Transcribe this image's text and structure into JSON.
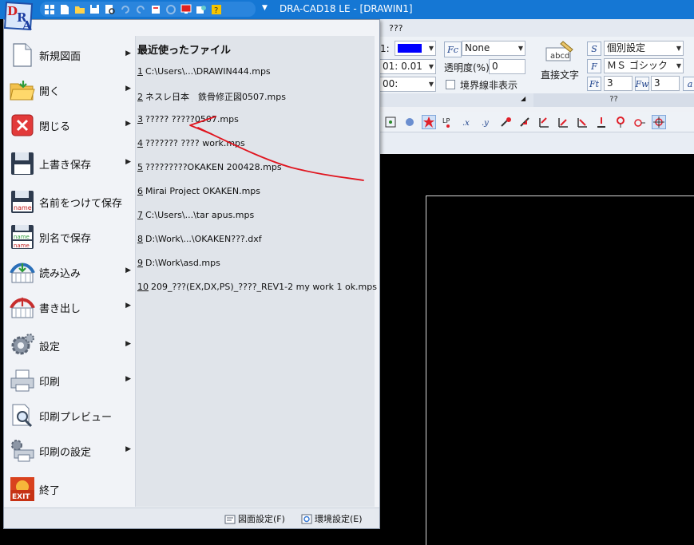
{
  "window": {
    "title": "DRA-CAD18 LE - [DRAWIN1]",
    "accent": "#1577d4"
  },
  "menubar": {
    "visible_item": "???"
  },
  "ribbon": {
    "line_color_label": "1:",
    "line_color_swatch": "#0000ff",
    "line_scale": "01: 0.01",
    "line_style_label": "00:",
    "fill_value": "None",
    "transparency_label": "透明度(%)",
    "transparency_value": "0",
    "hide_border_label": "境界線非表示",
    "direct_text_label": "直接文字",
    "style_value": "個別設定",
    "font_value": "ＭＳ ゴシック",
    "size1_value": "3",
    "size2_value": "3",
    "group_caption": "??"
  },
  "app_menu": {
    "items": [
      {
        "label": "新規図面",
        "icon": "new-document-icon",
        "has_submenu": true
      },
      {
        "label": "開く",
        "icon": "open-folder-icon",
        "has_submenu": true
      },
      {
        "label": "閉じる",
        "icon": "close-red-x-icon",
        "has_submenu": true
      },
      {
        "label": "上書き保存",
        "icon": "save-disk-icon",
        "has_submenu": true
      },
      {
        "label": "名前をつけて保存",
        "icon": "save-as-icon",
        "has_submenu": false
      },
      {
        "label": "別名で保存",
        "icon": "save-copy-icon",
        "has_submenu": false
      },
      {
        "label": "読み込み",
        "icon": "import-icon",
        "has_submenu": true
      },
      {
        "label": "書き出し",
        "icon": "export-icon",
        "has_submenu": true
      },
      {
        "label": "設定",
        "icon": "settings-gear-icon",
        "has_submenu": true
      },
      {
        "label": "印刷",
        "icon": "printer-icon",
        "has_submenu": true
      },
      {
        "label": "印刷プレビュー",
        "icon": "print-preview-icon",
        "has_submenu": false
      },
      {
        "label": "印刷の設定",
        "icon": "print-settings-icon",
        "has_submenu": true
      },
      {
        "label": "終了",
        "icon": "exit-icon",
        "has_submenu": false
      }
    ],
    "recent": {
      "title": "最近使ったファイル",
      "files": [
        {
          "num": "1",
          "name": "C:\\Users\\...\\DRAWIN444.mps"
        },
        {
          "num": "2",
          "name": "ネスレ日本　鉄骨修正図0507.mps"
        },
        {
          "num": "3",
          "name": "????? ?????0507.mps"
        },
        {
          "num": "4",
          "name": "??????? ???? work.mps"
        },
        {
          "num": "5",
          "name": "?????????OKAKEN 200428.mps"
        },
        {
          "num": "6",
          "name": "Mirai Project OKAKEN.mps"
        },
        {
          "num": "7",
          "name": "C:\\Users\\...\\tar apus.mps"
        },
        {
          "num": "8",
          "name": "D:\\Work\\...\\OKAKEN???.dxf"
        },
        {
          "num": "9",
          "name": "D:\\Work\\asd.mps"
        },
        {
          "num": "10",
          "name": "209_???(EX,DX,PS)_????_REV1-2 my work 1 ok.mps"
        }
      ]
    },
    "footer": {
      "drawing_settings": "図面設定(F)",
      "environment_settings": "環境設定(E)"
    }
  },
  "annotation_color": "#e0141e"
}
